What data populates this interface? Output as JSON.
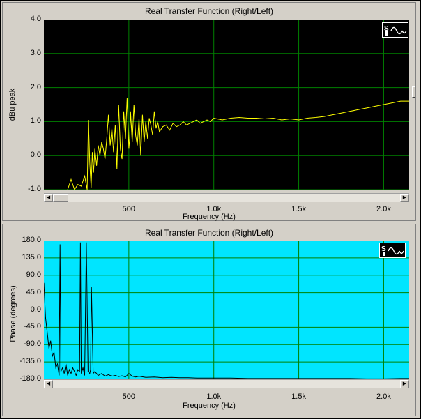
{
  "chart_data": [
    {
      "type": "line",
      "title": "Real Transfer Function (Right/Left)",
      "xlabel": "Frequency (Hz)",
      "ylabel": "dBu peak",
      "xlim": [
        0,
        2150
      ],
      "ylim": [
        -1.0,
        4.0
      ],
      "xticks": [
        500,
        1000,
        1500,
        2000
      ],
      "xtick_labels": [
        "500",
        "1.0k",
        "1.5k",
        "2.0k"
      ],
      "yticks": [
        -1.0,
        0.0,
        1.0,
        2.0,
        3.0,
        4.0
      ],
      "ytick_labels": [
        "-1.0",
        "0.0",
        "1.0",
        "2.0",
        "3.0",
        "4.0"
      ],
      "grid": true,
      "background": "#000000",
      "grid_color": "#008000",
      "line_color": "#ffff00",
      "series": [
        {
          "x": [
            140,
            160,
            180,
            200,
            220,
            240,
            255,
            262,
            270,
            278,
            285,
            292,
            300,
            310,
            320,
            330,
            340,
            350,
            360,
            370,
            380,
            390,
            400,
            410,
            420,
            430,
            440,
            450,
            460,
            470,
            480,
            490,
            500,
            505,
            510,
            520,
            530,
            540,
            550,
            560,
            570,
            580,
            590,
            600,
            610,
            620,
            630,
            640,
            650,
            660,
            670,
            680,
            700,
            720,
            740,
            760,
            780,
            800,
            820,
            840,
            860,
            880,
            900,
            920,
            940,
            960,
            980,
            1000,
            1050,
            1100,
            1150,
            1200,
            1250,
            1300,
            1350,
            1400,
            1450,
            1500,
            1550,
            1600,
            1650,
            1700,
            1750,
            1800,
            1850,
            1900,
            1950,
            2000,
            2050,
            2100,
            2150
          ],
          "y": [
            -1.0,
            -0.7,
            -1.0,
            -0.85,
            -0.9,
            -0.6,
            -1.0,
            1.05,
            -0.2,
            -0.95,
            0.1,
            -0.5,
            0.2,
            -0.3,
            0.3,
            0.0,
            0.4,
            0.2,
            -0.1,
            0.5,
            1.2,
            0.3,
            0.8,
            0.1,
            0.9,
            -0.4,
            1.5,
            0.2,
            -0.1,
            1.3,
            0.5,
            1.7,
            0.2,
            0.5,
            1.3,
            0.4,
            1.5,
            0.6,
            0.3,
            1.1,
            0.0,
            1.2,
            0.4,
            1.0,
            0.5,
            1.1,
            0.9,
            0.6,
            1.3,
            0.8,
            1.0,
            0.7,
            0.85,
            0.9,
            0.75,
            0.95,
            0.85,
            0.9,
            1.0,
            0.9,
            0.95,
            1.0,
            1.05,
            0.95,
            1.0,
            1.05,
            1.0,
            1.1,
            1.05,
            1.1,
            1.12,
            1.1,
            1.1,
            1.08,
            1.1,
            1.05,
            1.08,
            1.05,
            1.1,
            1.12,
            1.15,
            1.2,
            1.25,
            1.3,
            1.35,
            1.4,
            1.45,
            1.5,
            1.55,
            1.6,
            1.6
          ]
        }
      ]
    },
    {
      "type": "line",
      "title": "Real Transfer Function (Right/Left)",
      "xlabel": "Frequency (Hz)",
      "ylabel": "Phase (degrees)",
      "xlim": [
        0,
        2150
      ],
      "ylim": [
        -180.0,
        180.0
      ],
      "xticks": [
        500,
        1000,
        1500,
        2000
      ],
      "xtick_labels": [
        "500",
        "1.0k",
        "1.5k",
        "2.0k"
      ],
      "yticks": [
        -180.0,
        -135.0,
        -90.0,
        -45.0,
        0.0,
        45.0,
        90.0,
        135.0,
        180.0
      ],
      "ytick_labels": [
        "-180.0",
        "-135.0",
        "-90.0",
        "-45.0",
        "0.0",
        "45.0",
        "90.0",
        "135.0",
        "180.0"
      ],
      "grid": true,
      "background": "#00e5ff",
      "grid_color": "#008000",
      "line_color": "#000000",
      "series": [
        {
          "x": [
            0,
            10,
            20,
            30,
            40,
            50,
            60,
            70,
            80,
            90,
            95,
            100,
            110,
            120,
            130,
            140,
            150,
            160,
            170,
            180,
            190,
            200,
            210,
            215,
            220,
            230,
            240,
            250,
            260,
            270,
            275,
            280,
            290,
            300,
            320,
            340,
            360,
            380,
            400,
            420,
            440,
            460,
            480,
            500,
            520,
            540,
            560,
            600,
            650,
            700,
            750,
            800,
            850,
            900,
            1000,
            1100,
            1200,
            1300,
            1400,
            1500,
            1600,
            1700,
            1800,
            1900,
            2000,
            2100,
            2150
          ],
          "y": [
            70,
            -20,
            -60,
            -100,
            -80,
            -120,
            -110,
            -150,
            -140,
            -170,
            170,
            -160,
            -150,
            -165,
            -140,
            -170,
            -155,
            -165,
            -150,
            -160,
            -170,
            -155,
            -160,
            175,
            -165,
            -150,
            -170,
            175,
            -160,
            -165,
            -155,
            60,
            -165,
            -160,
            -170,
            -165,
            -172,
            -168,
            -172,
            -170,
            -173,
            -171,
            -174,
            -165,
            -172,
            -174,
            -172,
            -175,
            -174,
            -176,
            -175,
            -176,
            -176,
            -177,
            -177,
            -177,
            -178,
            -178,
            -178,
            -178,
            -178,
            -178,
            -178,
            -179,
            -179,
            -178,
            -178
          ]
        }
      ]
    }
  ]
}
